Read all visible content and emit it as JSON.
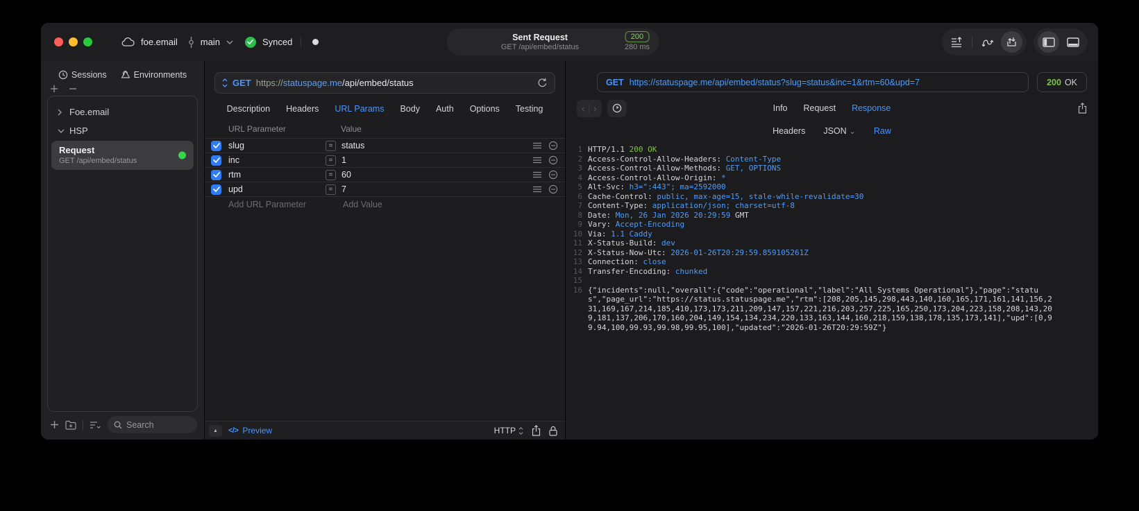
{
  "titlebar": {
    "project": "foe.email",
    "branch": "main",
    "sync_label": "Synced",
    "request_title": "Sent Request",
    "request_subtitle": "GET /api/embed/status",
    "status_badge": "200",
    "duration": "280 ms"
  },
  "sidebar": {
    "tab_sessions": "Sessions",
    "tab_environments": "Environments",
    "group_1": "Foe.email",
    "group_2": "HSP",
    "request_title": "Request",
    "request_subtitle": "GET /api/embed/status",
    "search_placeholder": "Search"
  },
  "request_editor": {
    "method": "GET",
    "url_scheme": "https://",
    "url_host": "statuspage.me",
    "url_path": "/api/embed/status",
    "tabs": [
      "Description",
      "Headers",
      "URL Params",
      "Body",
      "Auth",
      "Options",
      "Testing"
    ],
    "active_tab": "URL Params",
    "params": {
      "col_name": "URL Parameter",
      "col_value": "Value",
      "rows": [
        {
          "name": "slug",
          "value": "status",
          "checked": true
        },
        {
          "name": "inc",
          "value": "1",
          "checked": true
        },
        {
          "name": "rtm",
          "value": "60",
          "checked": true
        },
        {
          "name": "upd",
          "value": "7",
          "checked": true
        }
      ],
      "add_name": "Add URL Parameter",
      "add_value": "Add Value"
    },
    "footer": {
      "preview": "Preview",
      "protocol": "HTTP"
    }
  },
  "response_viewer": {
    "method": "GET",
    "url": "https://statuspage.me/api/embed/status?slug=status&inc=1&rtm=60&upd=7",
    "status_code": "200",
    "status_text": "OK",
    "tabs": [
      "Info",
      "Request",
      "Response"
    ],
    "active_tab": "Response",
    "view_tabs": [
      "Headers",
      "JSON",
      "Raw"
    ],
    "active_view": "Raw",
    "lines": [
      {
        "n": "1",
        "segs": [
          {
            "t": "HTTP/1.1 ",
            "c": "p"
          },
          {
            "t": "200 OK",
            "c": "g"
          }
        ]
      },
      {
        "n": "2",
        "segs": [
          {
            "t": "Access-Control-Allow-Headers: ",
            "c": "p"
          },
          {
            "t": "Content-Type",
            "c": "b"
          }
        ]
      },
      {
        "n": "3",
        "segs": [
          {
            "t": "Access-Control-Allow-Methods: ",
            "c": "p"
          },
          {
            "t": "GET, OPTIONS",
            "c": "b"
          }
        ]
      },
      {
        "n": "4",
        "segs": [
          {
            "t": "Access-Control-Allow-Origin: ",
            "c": "p"
          },
          {
            "t": "*",
            "c": "b"
          }
        ]
      },
      {
        "n": "5",
        "segs": [
          {
            "t": "Alt-Svc: ",
            "c": "p"
          },
          {
            "t": "h3=\":443\"; ma=2592000",
            "c": "b"
          }
        ]
      },
      {
        "n": "6",
        "segs": [
          {
            "t": "Cache-Control: ",
            "c": "p"
          },
          {
            "t": "public, max-age=15, stale-while-revalidate=30",
            "c": "b"
          }
        ]
      },
      {
        "n": "7",
        "segs": [
          {
            "t": "Content-Type: ",
            "c": "p"
          },
          {
            "t": "application/json; charset=utf-8",
            "c": "b"
          }
        ]
      },
      {
        "n": "8",
        "segs": [
          {
            "t": "Date: ",
            "c": "p"
          },
          {
            "t": "Mon, 26 Jan 2026 20:29:59",
            "c": "b"
          },
          {
            "t": " GMT",
            "c": "p"
          }
        ]
      },
      {
        "n": "9",
        "segs": [
          {
            "t": "Vary: ",
            "c": "p"
          },
          {
            "t": "Accept-Encoding",
            "c": "b"
          }
        ]
      },
      {
        "n": "10",
        "segs": [
          {
            "t": "Via: ",
            "c": "p"
          },
          {
            "t": "1.1 Caddy",
            "c": "b"
          }
        ]
      },
      {
        "n": "11",
        "segs": [
          {
            "t": "X-Status-Build: ",
            "c": "p"
          },
          {
            "t": "dev",
            "c": "b"
          }
        ]
      },
      {
        "n": "12",
        "segs": [
          {
            "t": "X-Status-Now-Utc: ",
            "c": "p"
          },
          {
            "t": "2026-01-26T20:29:59.859105261Z",
            "c": "b"
          }
        ]
      },
      {
        "n": "13",
        "segs": [
          {
            "t": "Connection: ",
            "c": "p"
          },
          {
            "t": "close",
            "c": "b"
          }
        ]
      },
      {
        "n": "14",
        "segs": [
          {
            "t": "Transfer-Encoding: ",
            "c": "p"
          },
          {
            "t": "chunked",
            "c": "b"
          }
        ]
      },
      {
        "n": "15",
        "segs": []
      },
      {
        "n": "16",
        "segs": [
          {
            "t": "{\"incidents\":null,\"overall\":{\"code\":\"operational\",\"label\":\"All Systems Operational\"},\"page\":\"status\",\"page_url\":\"https://status.statuspage.me\",\"rtm\":[208,205,145,298,443,140,160,165,171,161,141,156,231,169,167,214,185,410,173,173,211,209,147,157,221,216,203,257,225,165,250,173,204,223,158,208,143,209,181,137,206,170,160,204,149,154,134,234,220,133,163,144,160,218,159,138,178,135,173,141],\"upd\":[0,99.94,100,99.93,99.98,99.95,100],\"updated\":\"2026-01-26T20:29:59Z\"}",
            "c": "p"
          }
        ]
      }
    ]
  },
  "glyphs": {
    "expand": "▲",
    "equals": "=",
    "chevron_left": "‹",
    "chevron_right": "›",
    "chevron_down": "⌄",
    "code": "</>",
    "json_chevron": "⌄"
  },
  "colors": {
    "accent_blue": "#4a94ff",
    "response_value_blue": "#4f9cf7",
    "status_green": "#7ec14d",
    "badge_green": "#8bd45c",
    "request_dot_green": "#32d74b"
  }
}
